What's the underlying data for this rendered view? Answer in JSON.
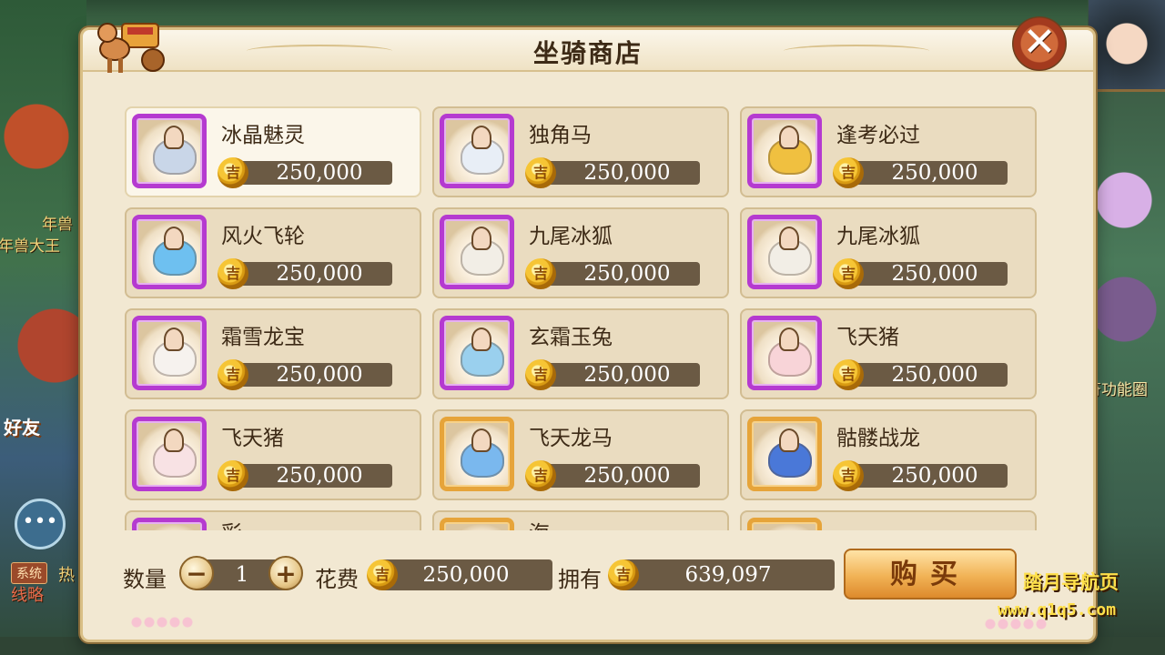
{
  "window": {
    "title": "坐骑商店"
  },
  "background": {
    "labels": [
      "年兽大王",
      "年兽",
      "好友",
      "符功能圈"
    ],
    "chat_icon": "•••",
    "system_tag": "系统",
    "system_text": "热",
    "bottom_text": "线略"
  },
  "items": [
    {
      "name": "冰晶魅灵",
      "price": "250,000",
      "frame": "purple",
      "mount_color": "#c9d6e8",
      "selected": true
    },
    {
      "name": "独角马",
      "price": "250,000",
      "frame": "purple",
      "mount_color": "#e8eef6",
      "selected": false
    },
    {
      "name": "逢考必过",
      "price": "250,000",
      "frame": "purple",
      "mount_color": "#f0c040",
      "selected": false
    },
    {
      "name": "风火飞轮",
      "price": "250,000",
      "frame": "purple",
      "mount_color": "#6ec0f0",
      "selected": false
    },
    {
      "name": "九尾冰狐",
      "price": "250,000",
      "frame": "purple",
      "mount_color": "#f2eee6",
      "selected": false
    },
    {
      "name": "九尾冰狐",
      "price": "250,000",
      "frame": "purple",
      "mount_color": "#f2eee6",
      "selected": false
    },
    {
      "name": "霜雪龙宝",
      "price": "250,000",
      "frame": "purple",
      "mount_color": "#f6f2ee",
      "selected": false
    },
    {
      "name": "玄霜玉兔",
      "price": "250,000",
      "frame": "purple",
      "mount_color": "#9ad0ee",
      "selected": false
    },
    {
      "name": "飞天猪",
      "price": "250,000",
      "frame": "purple",
      "mount_color": "#f8d4d8",
      "selected": false
    },
    {
      "name": "飞天猪",
      "price": "250,000",
      "frame": "purple",
      "mount_color": "#f8e2e4",
      "selected": false
    },
    {
      "name": "飞天龙马",
      "price": "250,000",
      "frame": "orange",
      "mount_color": "#7ab8ee",
      "selected": false
    },
    {
      "name": "骷髅战龙",
      "price": "250,000",
      "frame": "orange",
      "mount_color": "#4a78d8",
      "selected": false
    }
  ],
  "partial_items": [
    {
      "name": "彩..."
    },
    {
      "name": "海..."
    },
    {
      "name": "..."
    }
  ],
  "footer": {
    "quantity_label": "数量",
    "quantity_value": "1",
    "minus": "−",
    "plus": "+",
    "cost_label": "花费",
    "cost_value": "250,000",
    "owned_label": "拥有",
    "owned_value": "639,097",
    "buy_label": "购买"
  },
  "watermark": {
    "line1": "踏月导航页",
    "line2": "www.q1q5.com"
  },
  "colors": {
    "selected_frame": "#b53ad0",
    "orange_frame": "#e6a43a",
    "price_bar": "#6b5a44",
    "buy_button": "#f1b255"
  }
}
